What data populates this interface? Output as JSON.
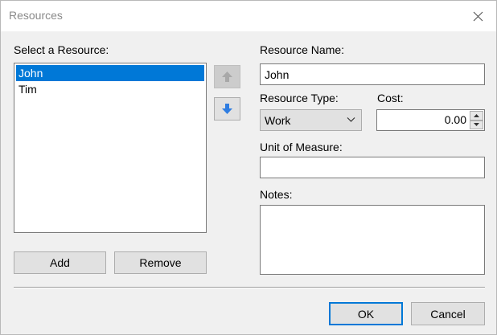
{
  "window": {
    "title": "Resources"
  },
  "resource_list": {
    "label": "Select a Resource:",
    "items": [
      {
        "label": "John",
        "selected": true
      },
      {
        "label": "Tim",
        "selected": false
      }
    ]
  },
  "buttons": {
    "add": "Add",
    "remove": "Remove",
    "ok": "OK",
    "cancel": "Cancel",
    "move_up_icon": "arrow-up-icon",
    "move_down_icon": "arrow-down-icon"
  },
  "form": {
    "resource_name_label": "Resource Name:",
    "resource_name_value": "John",
    "resource_type_label": "Resource Type:",
    "resource_type_value": "Work",
    "cost_label": "Cost:",
    "cost_value": "0.00",
    "unit_label": "Unit of Measure:",
    "unit_value": "",
    "notes_label": "Notes:",
    "notes_value": ""
  },
  "colors": {
    "selection": "#0078d7",
    "arrow_active": "#2f7de1",
    "arrow_disabled": "#a8a8a8"
  }
}
